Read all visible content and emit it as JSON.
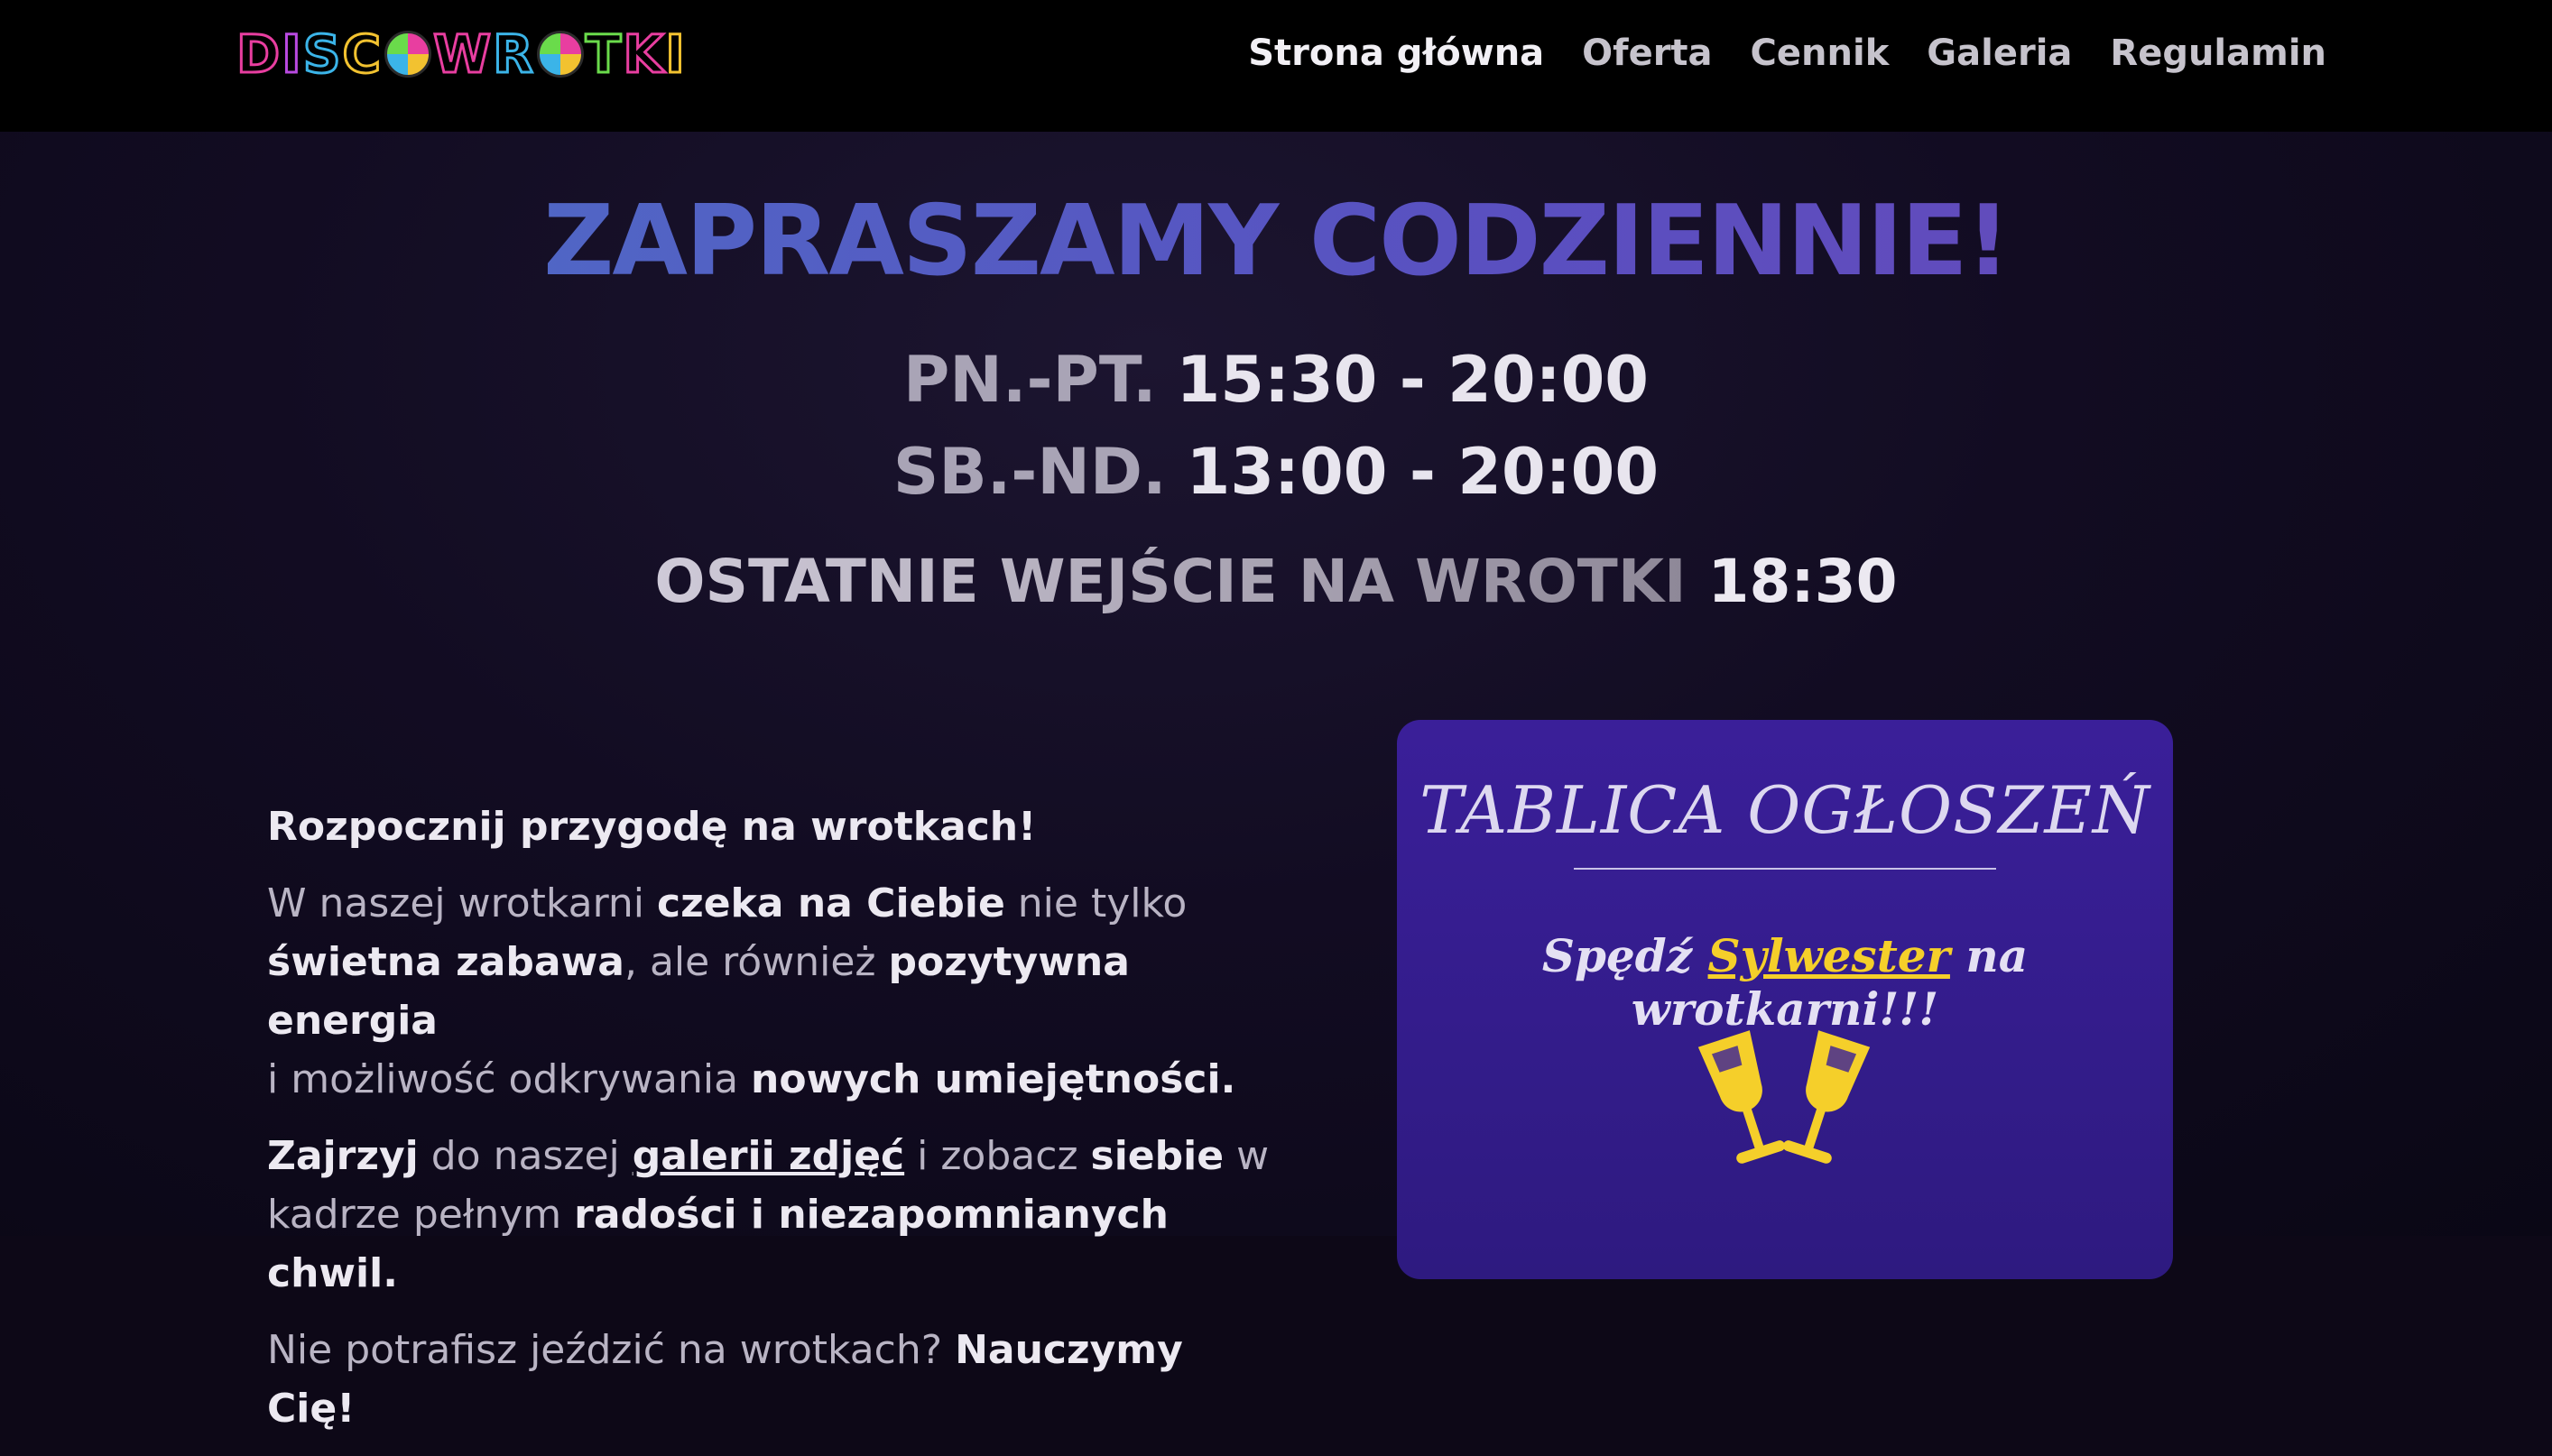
{
  "nav": {
    "logo_text": "DISCOWROTKI",
    "items": [
      {
        "label": "Strona główna",
        "active": true
      },
      {
        "label": "Oferta"
      },
      {
        "label": "Cennik"
      },
      {
        "label": "Galeria"
      },
      {
        "label": "Regulamin"
      }
    ]
  },
  "hero": {
    "headline": "ZAPRASZAMY CODZIENNIE!",
    "hours": [
      {
        "days": "PN.-PT.",
        "time": "15:30 - 20:00"
      },
      {
        "days": "SB.-ND.",
        "time": "13:00 - 20:00"
      }
    ],
    "last_entry": {
      "label": "OSTATNIE WEJŚCIE NA WROTKI",
      "time": "18:30"
    }
  },
  "about": {
    "lead": "Rozpocznij przygodę na wrotkach!",
    "p1": [
      "W naszej wrotkarni ",
      "czeka na Ciebie",
      " nie tylko ",
      "świetna zabawa",
      ", ale również ",
      "pozytywna energia",
      " i możliwość odkrywania ",
      "nowych umiejętności."
    ],
    "p2": [
      "Zajrzyj",
      " do naszej ",
      "galerii zdjęć",
      " i zobacz ",
      "siebie",
      " w kadrze pełnym ",
      "radości i niezapomnianych chwil."
    ],
    "p3": [
      "Nie potrafisz jeździć na wrotkach? ",
      "Nauczymy Cię!"
    ]
  },
  "board": {
    "title": "TABLICA OGŁOSZEŃ",
    "msg_before": "Spędź ",
    "msg_link": "Sylwester",
    "msg_after": " na wrotkarni!!!",
    "icon": "champagne-glasses-icon",
    "accent": "#f5cf2a"
  }
}
